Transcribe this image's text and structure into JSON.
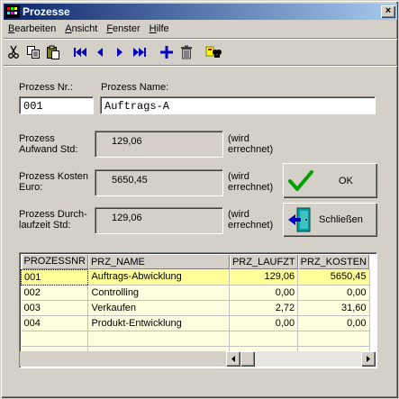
{
  "window": {
    "title": "Prozesse",
    "close_label": "×"
  },
  "menu": {
    "items": [
      {
        "label": "Bearbeiten",
        "accel": "B",
        "rest": "earbeiten"
      },
      {
        "label": "Ansicht",
        "accel": "A",
        "rest": "nsicht"
      },
      {
        "label": "Fenster",
        "accel": "F",
        "rest": "enster"
      },
      {
        "label": "Hilfe",
        "accel": "H",
        "rest": "ilfe"
      }
    ]
  },
  "toolbar": {
    "buttons": [
      "cut-icon",
      "copy-icon",
      "paste-icon",
      "first-record-icon",
      "previous-record-icon",
      "next-record-icon",
      "last-record-icon",
      "add-record-icon",
      "delete-record-icon",
      "search-icon"
    ],
    "accent": "#0000c0"
  },
  "form": {
    "prozess_nr_label": "Prozess Nr.:",
    "prozess_nr_value": "001",
    "prozess_name_label": "Prozess Name:",
    "prozess_name_value": "Auftrags-A",
    "aufwand_label_1": "Prozess",
    "aufwand_label_2": "Aufwand Std:",
    "aufwand_value": "129,06",
    "kosten_label_1": "Prozess Kosten",
    "kosten_label_2": "Euro:",
    "kosten_value": "5650,45",
    "laufzeit_label_1": "Prozess Durch-",
    "laufzeit_label_2": "laufzeit Std:",
    "laufzeit_value": "129,06",
    "computed_note_1": "(wird",
    "computed_note_2": "errechnet)"
  },
  "buttons": {
    "ok_label": "OK",
    "close_label": "Schließen"
  },
  "grid": {
    "columns": [
      "PROZESSNR",
      "PRZ_NAME",
      "PRZ_LAUFZT",
      "PRZ_KOSTEN"
    ],
    "rows": [
      {
        "nr": "001",
        "name": "Auftrags-Abwicklung",
        "laufzt": "129,06",
        "kosten": "5650,45",
        "selected": true
      },
      {
        "nr": "002",
        "name": "Controlling",
        "laufzt": "0,00",
        "kosten": "0,00",
        "selected": false
      },
      {
        "nr": "003",
        "name": "Verkaufen",
        "laufzt": "2,72",
        "kosten": "31,60",
        "selected": false
      },
      {
        "nr": "004",
        "name": "Produkt-Entwicklung",
        "laufzt": "0,00",
        "kosten": "0,00",
        "selected": false
      }
    ],
    "selected_color": "#ffff99",
    "row_color": "#ffffe0"
  }
}
